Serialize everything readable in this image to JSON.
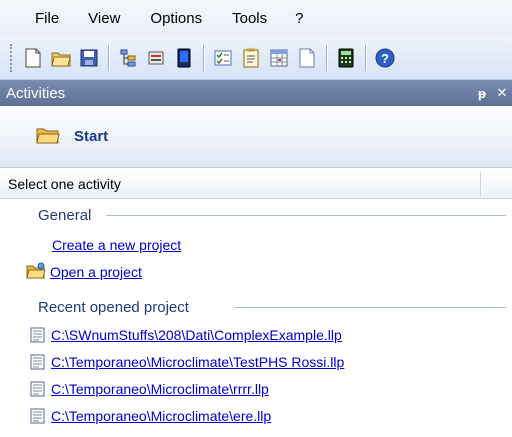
{
  "menu": {
    "file": "File",
    "view": "View",
    "options": "Options",
    "tools": "Tools",
    "help": "?"
  },
  "toolbar": {
    "icons": [
      "new-document-icon",
      "open-folder-icon",
      "save-icon",
      "tree-icon",
      "form-icon",
      "device-icon",
      "checklist-icon",
      "report-icon",
      "table-icon",
      "page-icon",
      "calculator-icon",
      "help-icon"
    ]
  },
  "panel": {
    "title": "Activities",
    "pin": "ᵽ",
    "close": "✕"
  },
  "start": {
    "label": "Start"
  },
  "list": {
    "header": "Select one activity",
    "general_title": "General",
    "create_project": "Create a new project",
    "open_project": "Open a project",
    "recent_title": "Recent opened project",
    "recent": [
      "C:\\SWnumStuffs\\208\\Dati\\ComplexExample.llp",
      "C:\\Temporaneo\\Microclimate\\TestPHS Rossi.llp",
      "C:\\Temporaneo\\Microclimate\\rrrr.llp",
      "C:\\Temporaneo\\Microclimate\\ere.llp"
    ]
  },
  "colors": {
    "panel_header": "#6a7fa4",
    "link": "#0000cc",
    "group_text": "#1f3a7a",
    "accent": "#1a3a8c"
  }
}
